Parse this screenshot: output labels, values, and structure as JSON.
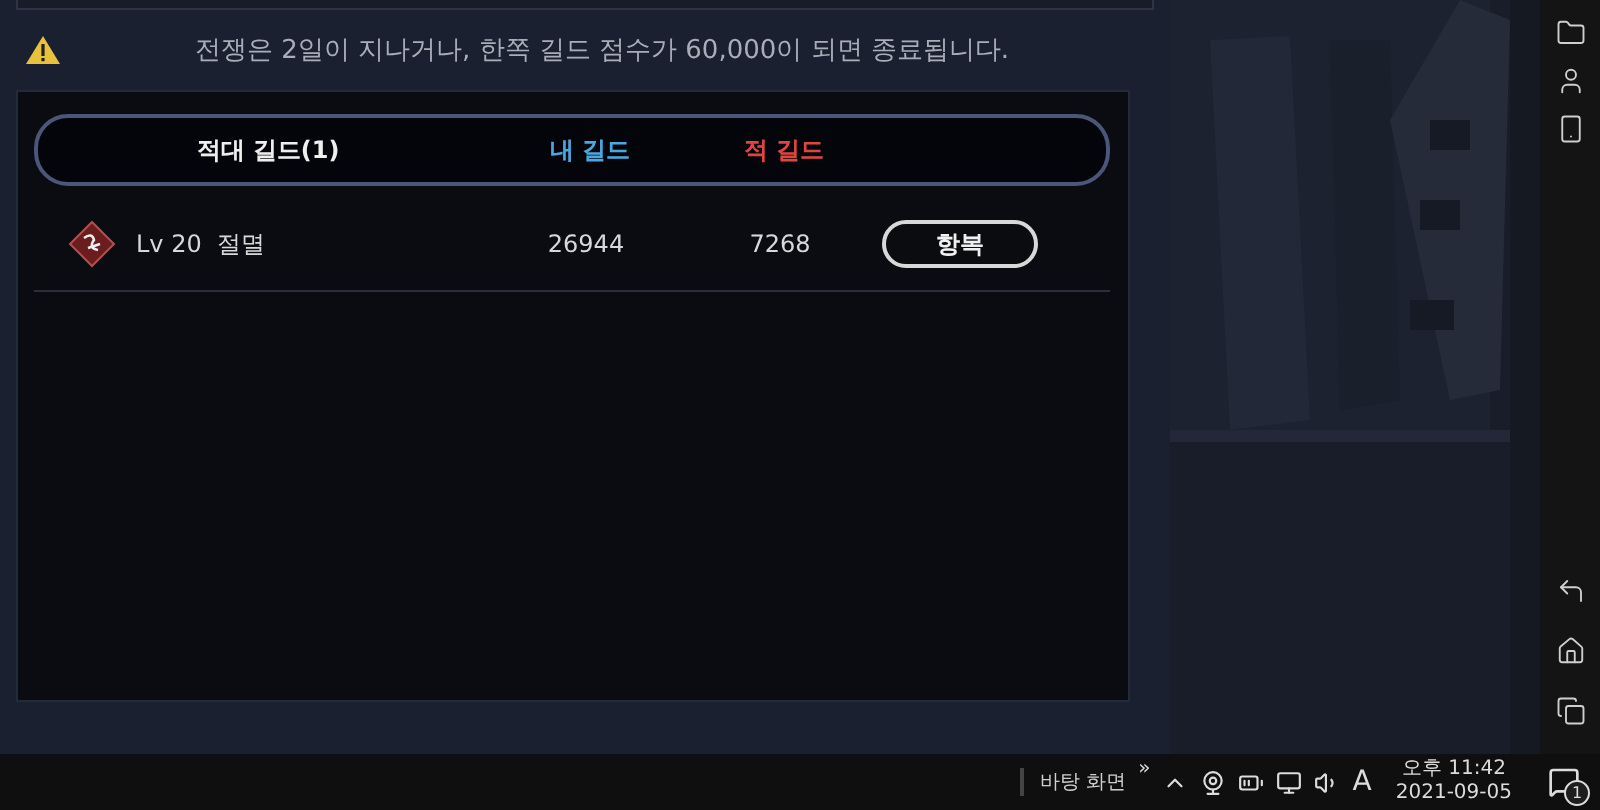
{
  "notice": {
    "text": "전쟁은 2일이 지나거나, 한쪽 길드 점수가 60,000이 되면 종료됩니다."
  },
  "table": {
    "columns": [
      {
        "label": "적대 길드(1)",
        "kind": "plain"
      },
      {
        "label": "내 길드",
        "kind": "mine"
      },
      {
        "label": "적 길드",
        "kind": "enemy"
      }
    ],
    "rows": [
      {
        "name": "Lv 20  절멸",
        "my_score": "26944",
        "enemy_score": "7268",
        "action": "항복"
      }
    ]
  },
  "taskbar": {
    "desktop_label": "바탕 화면",
    "overflow": "»",
    "ime": "A",
    "time": "오후 11:42",
    "date": "2021-09-05",
    "notifications": "1"
  }
}
